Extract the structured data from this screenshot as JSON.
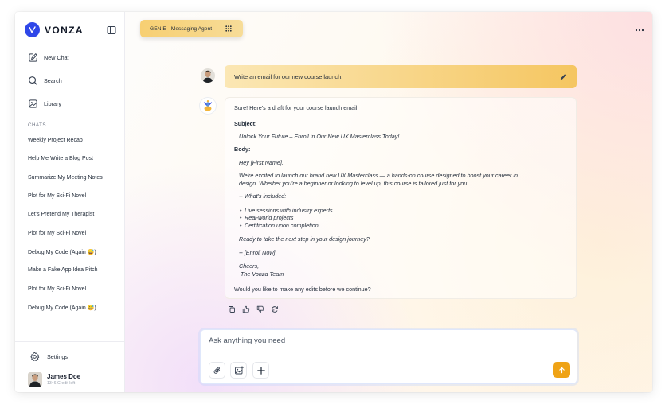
{
  "brand": {
    "name": "VONZA"
  },
  "sidebar": {
    "nav": [
      {
        "label": "New Chat",
        "icon": "new-chat-icon"
      },
      {
        "label": "Search",
        "icon": "search-icon"
      },
      {
        "label": "Library",
        "icon": "library-icon"
      }
    ],
    "section_label": "CHATS",
    "chats": [
      "Weekly Project Recap",
      "Help Me Write a Blog Post",
      "Summarize My Meeting Notes",
      "Plot for My Sci-Fi Novel",
      "Let's Pretend My Therapist",
      "Plot for My Sci-Fi Novel",
      "Debug My Code (Again 😅)",
      "Make a Fake App Idea Pitch",
      "Plot for My Sci-Fi Novel",
      "Debug My Code (Again 😅)"
    ],
    "settings_label": "Settings",
    "user": {
      "name": "James Doe",
      "credits": "1346 Credit left"
    }
  },
  "header": {
    "agent_label": "GENIE - Messaging Agent"
  },
  "conversation": {
    "user_message": "Write an email for our new course launch.",
    "bot": {
      "intro": "Sure! Here's a draft for your course launch email:",
      "subject_label": "Subject:",
      "subject": "Unlock Your Future – Enroll in Our New UX Masterclass Today!",
      "body_label": "Body:",
      "greeting": "Hey [First Name],",
      "para1_line1": "We're excited to launch our brand new UX Masterclass — a hands-on course designed to boost your career in",
      "para1_line2": "design. Whether you're a beginner or looking to level up, this course is tailored just for you.",
      "included": "-- What's included:",
      "bullets": [
        "Live sessions with industry experts",
        "Real-world projects",
        "Certification upon completion"
      ],
      "cta_question": "Ready to take the next step in your design journey?",
      "cta_link": "-- [Enroll Now]",
      "signoff": "Cheers,",
      "team": "The Vonza Team",
      "followup": "Would you like to make any edits before we continue?"
    }
  },
  "composer": {
    "placeholder": "Ask anything you need"
  },
  "colors": {
    "brand_blue": "#2f47e8",
    "accent_orange": "#efa316",
    "bubble_gold": "#f5c661"
  }
}
